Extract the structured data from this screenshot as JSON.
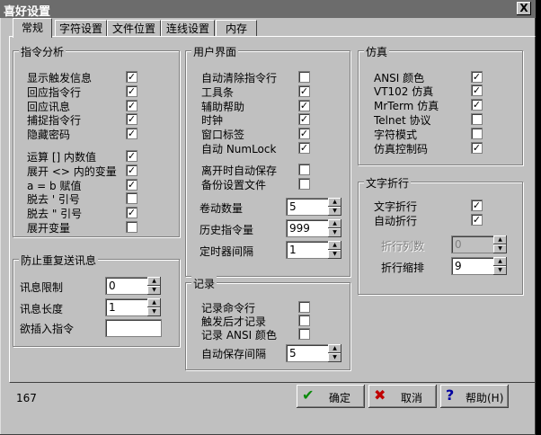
{
  "window": {
    "title": "喜好设置",
    "close_label": "X"
  },
  "tabs": [
    {
      "label": "常规",
      "active": true
    },
    {
      "label": "字符设置",
      "active": false
    },
    {
      "label": "文件位置",
      "active": false
    },
    {
      "label": "连线设置",
      "active": false
    },
    {
      "label": "内存",
      "active": false
    }
  ],
  "command_analysis": {
    "title": "指令分析",
    "items": [
      {
        "label": "显示触发信息",
        "checked": true
      },
      {
        "label": "回应指令行",
        "checked": true
      },
      {
        "label": "回应讯息",
        "checked": true
      },
      {
        "label": "捕捉指令行",
        "checked": true
      },
      {
        "label": "隐藏密码",
        "checked": true
      },
      {
        "label": "运算 [] 内数值",
        "checked": true
      },
      {
        "label": "展开 <> 内的变量",
        "checked": true
      },
      {
        "label": "a = b 赋值",
        "checked": true
      },
      {
        "label": "脱去 ' 引号",
        "checked": false
      },
      {
        "label": "脱去 \" 引号",
        "checked": true
      },
      {
        "label": "展开变量",
        "checked": false
      }
    ]
  },
  "repeat_prevention": {
    "title": "防止重复送讯息",
    "fields": [
      {
        "label": "讯息限制",
        "value": "0"
      },
      {
        "label": "讯息长度",
        "value": "1"
      }
    ],
    "insert_label": "欲插入指令",
    "insert_value": ""
  },
  "user_interface": {
    "title": "用户界面",
    "items": [
      {
        "label": "自动清除指令行",
        "checked": false
      },
      {
        "label": "工具条",
        "checked": true
      },
      {
        "label": "辅助帮助",
        "checked": true
      },
      {
        "label": "时钟",
        "checked": true
      },
      {
        "label": "窗口标签",
        "checked": true
      },
      {
        "label": "自动 NumLock",
        "checked": true
      },
      {
        "label": "离开时自动保存",
        "checked": false
      },
      {
        "label": "备份设置文件",
        "checked": false
      }
    ],
    "spinners": [
      {
        "label": "卷动数量",
        "value": "5"
      },
      {
        "label": "历史指令量",
        "value": "999"
      },
      {
        "label": "定时器间隔",
        "value": "1"
      }
    ]
  },
  "logging": {
    "title": "记录",
    "items": [
      {
        "label": "记录命令行",
        "checked": false
      },
      {
        "label": "触发后才记录",
        "checked": false
      },
      {
        "label": "记录 ANSI 颜色",
        "checked": false
      }
    ],
    "autosave_label": "自动保存间隔",
    "autosave_value": "5"
  },
  "emulation": {
    "title": "仿真",
    "items": [
      {
        "label": "ANSI 颜色",
        "checked": true
      },
      {
        "label": "VT102 仿真",
        "checked": true
      },
      {
        "label": "MrTerm 仿真",
        "checked": true
      },
      {
        "label": "Telnet 协议",
        "checked": false
      },
      {
        "label": "字符模式",
        "checked": false
      },
      {
        "label": "仿真控制码",
        "checked": true
      }
    ]
  },
  "word_wrap": {
    "title": "文字折行",
    "items": [
      {
        "label": "文字折行",
        "checked": true
      },
      {
        "label": "自动折行",
        "checked": true
      }
    ],
    "spinners": [
      {
        "label": "折行列数",
        "value": "0",
        "disabled": true
      },
      {
        "label": "折行缩排",
        "value": "9",
        "disabled": false
      }
    ]
  },
  "status": {
    "number": "167"
  },
  "buttons": {
    "ok": "确定",
    "cancel": "取消",
    "help": "帮助(H)"
  }
}
